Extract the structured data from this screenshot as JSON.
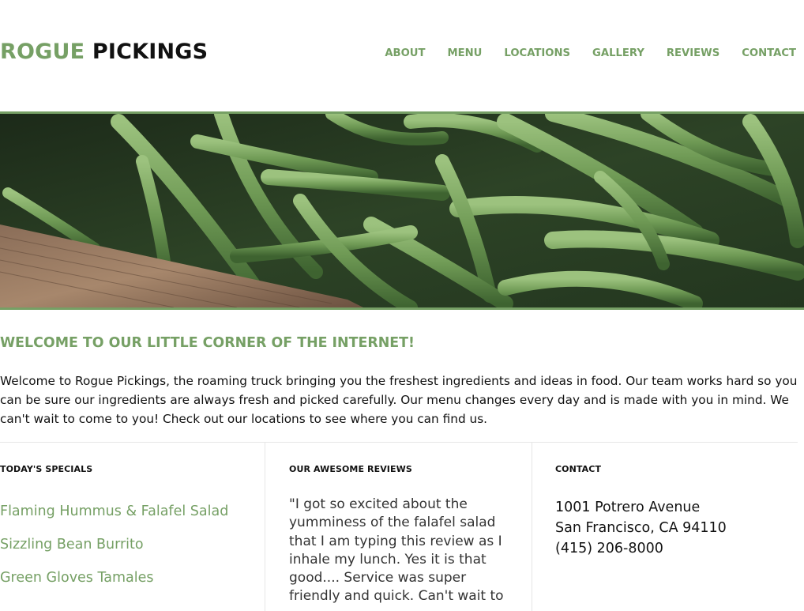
{
  "header": {
    "logo_word1": "ROGUE",
    "logo_word2": "PICKINGS"
  },
  "nav": {
    "items": [
      {
        "label": "ABOUT"
      },
      {
        "label": "MENU"
      },
      {
        "label": "LOCATIONS"
      },
      {
        "label": "GALLERY"
      },
      {
        "label": "REVIEWS"
      },
      {
        "label": "CONTACT"
      }
    ]
  },
  "hero": {
    "image": "green-beans-photo"
  },
  "welcome": {
    "title": "WELCOME TO OUR LITTLE CORNER OF THE INTERNET!",
    "body": "Welcome to Rogue Pickings, the roaming truck bringing you the freshest ingredients and ideas in food. Our team works hard so you can be sure our ingredients are always fresh and picked carefully. Our menu changes every day and is made with you in mind. We can't wait to come to you! Check out our locations to see where you can find us."
  },
  "specials": {
    "heading": "TODAY'S SPECIALS",
    "items": [
      {
        "label": "Flaming Hummus & Falafel Salad"
      },
      {
        "label": "Sizzling Bean Burrito"
      },
      {
        "label": "Green Gloves Tamales"
      }
    ]
  },
  "reviews": {
    "heading": "OUR AWESOME REVIEWS",
    "text": "\"I got so excited about the yumminess of the falafel salad that I am typing this review as I inhale my lunch. Yes it is that good.... Service was super friendly and quick. Can't wait to try more Rogue Pickings goodies!\""
  },
  "contact": {
    "heading": "CONTACT",
    "address_line1": "1001 Potrero Avenue",
    "address_line2": "San Francisco, CA 94110",
    "phone": "(415) 206-8000"
  },
  "colors": {
    "accent": "#76a065",
    "text": "#111111",
    "divider": "#e6e6e6"
  }
}
